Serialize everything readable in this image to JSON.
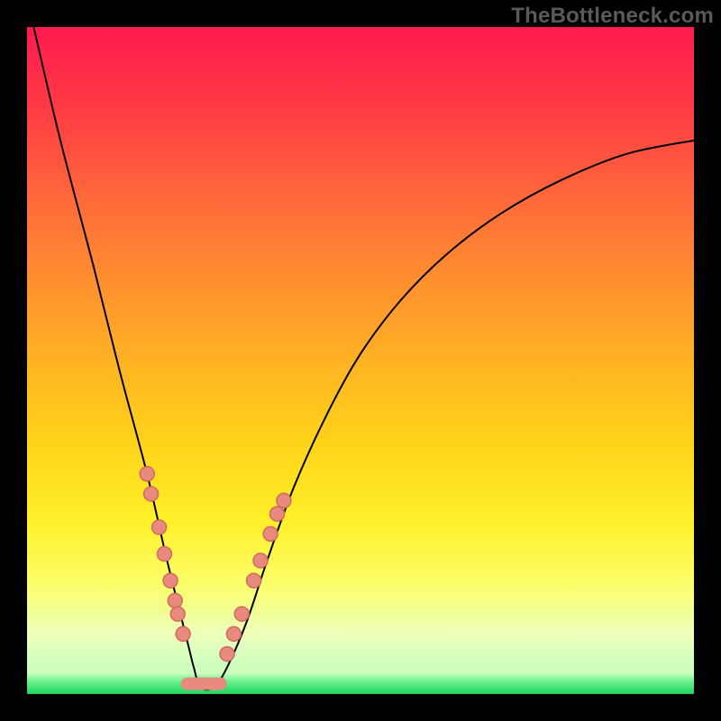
{
  "watermark": "TheBottleneck.com",
  "chart_data": {
    "type": "line",
    "title": "",
    "xlabel": "",
    "ylabel": "",
    "x_range": [
      0,
      100
    ],
    "y_range": [
      0,
      100
    ],
    "series": [
      {
        "name": "bottleneck-curve",
        "x": [
          1,
          5,
          10,
          14,
          18,
          21,
          24,
          25,
          26,
          28,
          30,
          33,
          36,
          40,
          45,
          50,
          56,
          63,
          71,
          80,
          90,
          100
        ],
        "y": [
          100,
          83,
          64,
          48,
          33,
          20,
          8,
          4,
          1,
          1,
          4,
          11,
          20,
          31,
          42,
          51,
          59,
          66,
          72,
          77,
          81,
          83
        ]
      }
    ],
    "highlight_points_left": [
      {
        "x": 18.0,
        "y": 33
      },
      {
        "x": 18.6,
        "y": 30
      },
      {
        "x": 19.8,
        "y": 25
      },
      {
        "x": 20.6,
        "y": 21
      },
      {
        "x": 21.5,
        "y": 17
      },
      {
        "x": 22.2,
        "y": 14
      },
      {
        "x": 22.6,
        "y": 12
      },
      {
        "x": 23.4,
        "y": 9
      }
    ],
    "highlight_points_right": [
      {
        "x": 30.0,
        "y": 6
      },
      {
        "x": 31.0,
        "y": 9
      },
      {
        "x": 32.2,
        "y": 12
      },
      {
        "x": 34.0,
        "y": 17
      },
      {
        "x": 35.0,
        "y": 20
      },
      {
        "x": 36.5,
        "y": 24
      },
      {
        "x": 37.5,
        "y": 27
      },
      {
        "x": 38.5,
        "y": 29
      }
    ],
    "trough": {
      "x_start": 24.0,
      "x_end": 29.0,
      "y": 1.0
    },
    "colors": {
      "curve": "#000000",
      "dot_fill": "#e88a7e",
      "dot_stroke": "#d06a5e",
      "gradient_top": "#ff1a4f",
      "gradient_bottom": "#1fd45f"
    }
  }
}
